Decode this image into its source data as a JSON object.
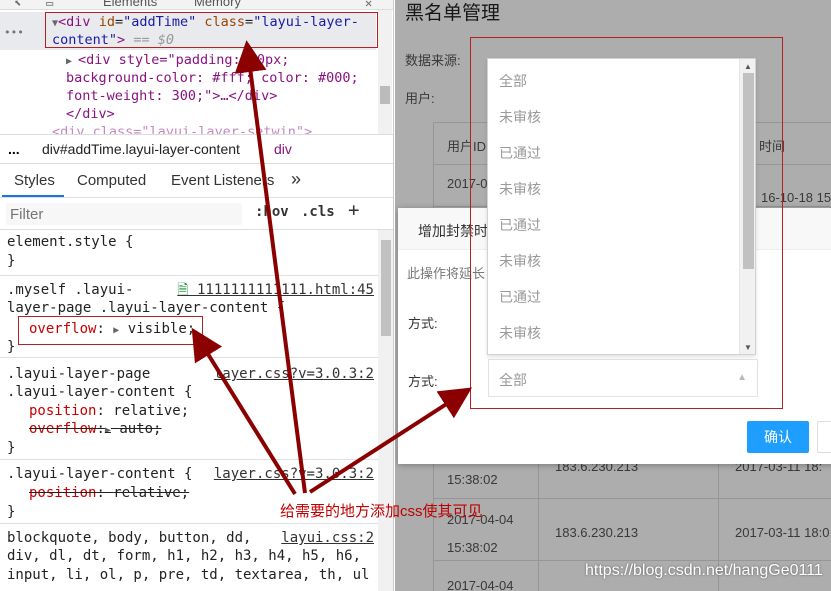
{
  "devtools": {
    "topbar": {
      "tab_elements": "Elements",
      "tab_memory": "Memory"
    },
    "dom": {
      "line1": {
        "tag": "div",
        "id_attr": "id",
        "id_val": "\"addTime\"",
        "class_attr": "class",
        "class_val_a": "\"layui-layer-",
        "class_val_b": "content\"",
        "dollar": "== $0"
      },
      "line2": "<div style=\"padding: 10px;",
      "line3": "background-color: #fff; color: #000;",
      "line4": "font-weight: 300;\">…</div>",
      "line5": "</div>",
      "line6": "<div class=\"layui-layer-setwin\">"
    },
    "breadcrumb": {
      "dots": "...",
      "path": "div#addTime.layui-layer-content",
      "last": "div"
    },
    "subtabs": {
      "styles": "Styles",
      "computed": "Computed",
      "listeners": "Event Listeners",
      "more": "»"
    },
    "filter": {
      "placeholder": "Filter",
      "hov": ":hov",
      "cls": ".cls",
      "plus": "+"
    },
    "rules": {
      "r1": {
        "sel": "element.style {",
        "close": "}"
      },
      "r2": {
        "sel1": ".myself .layui-",
        "sel2": "layer-page .layui-layer-content {",
        "source": "1111111111111.html:45",
        "prop": "overflow",
        "value": "visible;",
        "close": "}"
      },
      "r3": {
        "sel1": ".layui-layer-page",
        "sel2": ".layui-layer-content {",
        "source": "layer.css?v=3.0.3:2",
        "p1": "position",
        "v1": "relative;",
        "p2": "overflow",
        "v2": "auto;",
        "close": "}"
      },
      "r4": {
        "sel": ".layui-layer-content {",
        "source": "layer.css?v=3.0.3:2",
        "p1": "position",
        "v1": "relative;",
        "close": "}"
      },
      "r5": {
        "l1": "blockquote, body, button, dd,",
        "source": "layui.css:2",
        "l2": "div, dl, dt, form, h1, h2, h3, h4, h5, h6,",
        "l3": "input, li, ol, p, pre, td, textarea, th, ul"
      }
    }
  },
  "page": {
    "title": "黑名单管理",
    "data_source_label": "数据来源:",
    "user_label": "用户:",
    "table": {
      "col_userid": "用户ID",
      "col_time": "时间",
      "rows": [
        {
          "date": "2017-0",
          "ip": "",
          "time": "16-10-18 15:"
        },
        {
          "date": "15:38:02",
          "ip": "183.6.230.213",
          "time": "2017-03-11 18:"
        },
        {
          "date": "2017-04-04",
          "ip": "183.6.230.213",
          "time": "2017-03-11 18:0"
        },
        {
          "date": "15:38:02",
          "ip": "",
          "time": ""
        },
        {
          "date": "2017-04-04",
          "ip": "",
          "time": ""
        }
      ]
    },
    "dialog": {
      "title": "增加封禁时",
      "note": "此操作将延长",
      "label_mode1": "方式:",
      "label_mode2": "方式:",
      "select_value": "全部",
      "confirm": "确认"
    },
    "dropdown": {
      "options": [
        "全部",
        "未审核",
        "已通过",
        "未审核",
        "已通过",
        "未审核",
        "已通过",
        "未审核"
      ]
    }
  },
  "annotation": {
    "text": "给需要的地方添加css使其可见",
    "watermark": "https://blog.csdn.net/hangGe0111"
  },
  "colors": {
    "annotation": "#8b0000",
    "confirm_button": "#1e9fff",
    "css_prop": "#c80000"
  }
}
